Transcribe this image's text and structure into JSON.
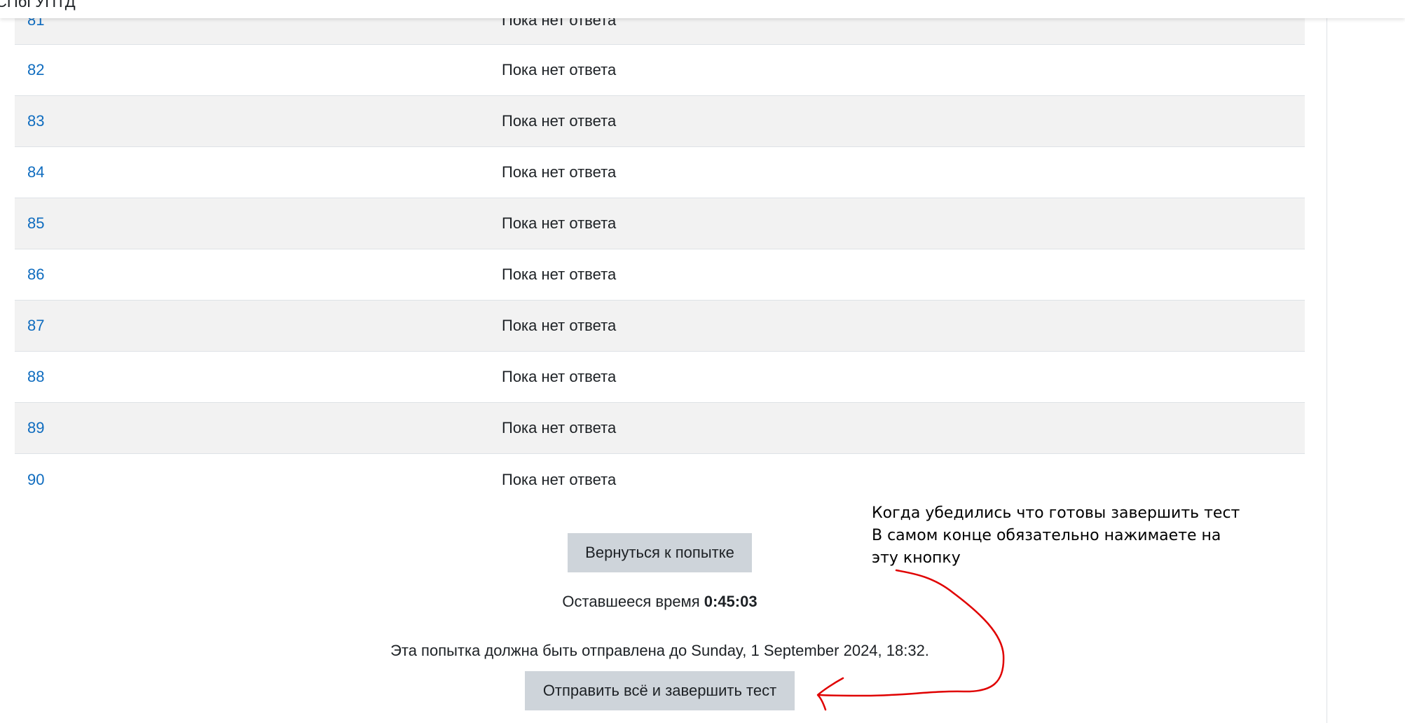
{
  "header": {
    "site_name": "СПбГУПТД"
  },
  "summary": {
    "rows": [
      {
        "number": "81",
        "status": "Пока нет ответа"
      },
      {
        "number": "82",
        "status": "Пока нет ответа"
      },
      {
        "number": "83",
        "status": "Пока нет ответа"
      },
      {
        "number": "84",
        "status": "Пока нет ответа"
      },
      {
        "number": "85",
        "status": "Пока нет ответа"
      },
      {
        "number": "86",
        "status": "Пока нет ответа"
      },
      {
        "number": "87",
        "status": "Пока нет ответа"
      },
      {
        "number": "88",
        "status": "Пока нет ответа"
      },
      {
        "number": "89",
        "status": "Пока нет ответа"
      },
      {
        "number": "90",
        "status": "Пока нет ответа"
      }
    ]
  },
  "actions": {
    "return_label": "Вернуться к попытке",
    "timer_label": "Оставшееся время",
    "timer_value": "0:45:03",
    "deadline_text": "Эта попытка должна быть отправлена до Sunday, 1 September 2024, 18:32.",
    "submit_label": "Отправить всё и завершить тест"
  },
  "annotation": {
    "text": "Когда убедились что готовы завершить тест В самом конце обязательно  нажимаете на эту кнопку",
    "color": "#e00000"
  },
  "colors": {
    "link": "#0f6cbf",
    "row_shade": "#f2f2f2",
    "button": "#ced4da"
  }
}
